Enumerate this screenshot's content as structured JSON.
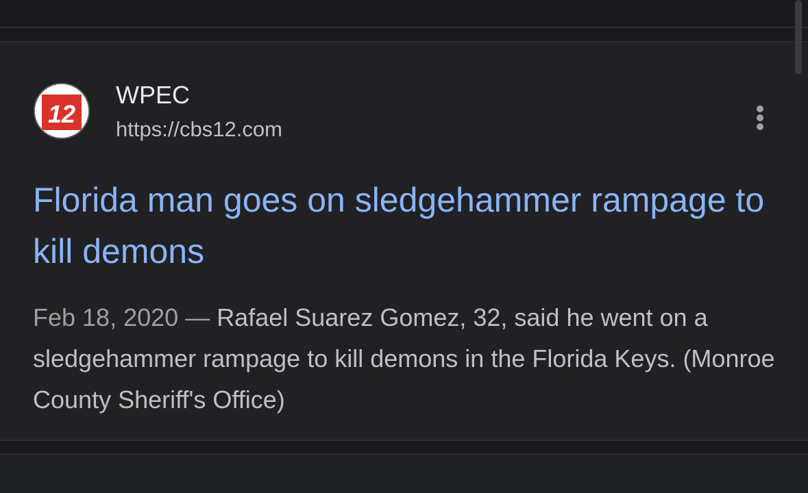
{
  "result": {
    "favicon": {
      "icon": "cbs12-logo-icon",
      "text": "12",
      "color": "#d9322b"
    },
    "site_name": "WPEC",
    "url": "https://cbs12.com",
    "more_icon": "more-vert-icon",
    "title": "Florida man goes on sledgehammer rampage to kill demons",
    "date": "Feb 18, 2020",
    "separator": " — ",
    "snippet": "Rafael Suarez Gomez, 32, said he went on a sledgehammer rampage to kill demons in the Florida Keys. (Monroe County Sheriff's Office)"
  },
  "colors": {
    "background": "#202124",
    "link": "#8ab4f8",
    "text": "#e8eaed",
    "secondary": "#bdc1c6"
  }
}
